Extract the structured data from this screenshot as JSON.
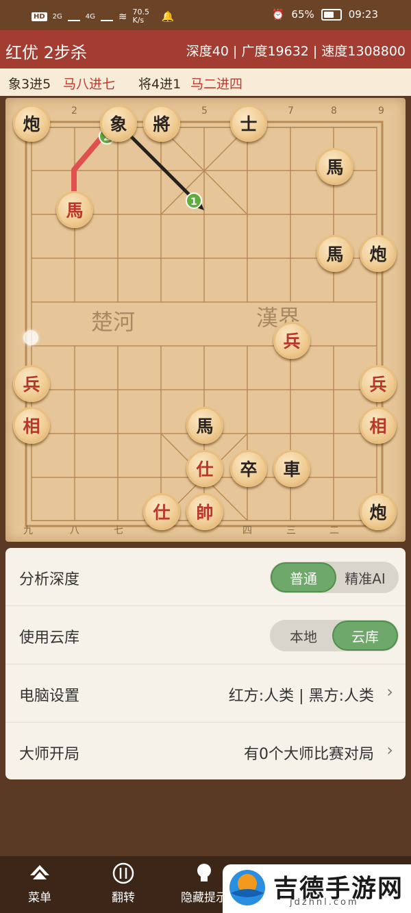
{
  "status_bar": {
    "hd": "HD",
    "sim1": "2G",
    "sim2": "4G",
    "speed": "70.5 K/s",
    "battery": "65%",
    "time": "09:23"
  },
  "title_bar": {
    "title": "红优 2步杀",
    "stats": "深度40 | 广度19632 | 速度1308800"
  },
  "move_bar": {
    "m1": "象3进5",
    "m2": "马八进七",
    "m3": "将4进1",
    "m4": "马二进四"
  },
  "board": {
    "top_numbers": [
      "2",
      "5",
      "7",
      "8",
      "9"
    ],
    "bottom_numbers": [
      "九",
      "八",
      "七",
      "四",
      "三",
      "二"
    ],
    "river_left": "楚河",
    "river_right": "漢界",
    "arrow_labels": [
      "1",
      "2"
    ],
    "pieces": {
      "p1": "炮",
      "p2": "象",
      "p3": "將",
      "p4": "士",
      "p5": "馬",
      "p6": "馬",
      "p7": "馬",
      "p8": "炮",
      "p9": "兵",
      "p10": "兵",
      "p11": "兵",
      "p12": "相",
      "p13": "相",
      "p14": "馬",
      "p15": "仕",
      "p16": "卒",
      "p17": "車",
      "p18": "仕",
      "p19": "帥",
      "p20": "炮"
    }
  },
  "settings": {
    "depth_label": "分析深度",
    "depth_opt1": "普通",
    "depth_opt2": "精准AI",
    "cloud_label": "使用云库",
    "cloud_opt1": "本地",
    "cloud_opt2": "云库",
    "computer_label": "电脑设置",
    "computer_value": "红方:人类 | 黑方:人类",
    "master_label": "大师开局",
    "master_value": "有0个大师比赛对局"
  },
  "nav": {
    "menu": "菜单",
    "flip": "翻转",
    "hide_hint": "隐藏提示"
  },
  "watermark": {
    "text": "吉德手游网",
    "url": "jdzhnl.com"
  },
  "colors": {
    "title_bar": "#a33d32",
    "red_piece_text": "#b8362a",
    "accent_green": "#6ea86a"
  }
}
